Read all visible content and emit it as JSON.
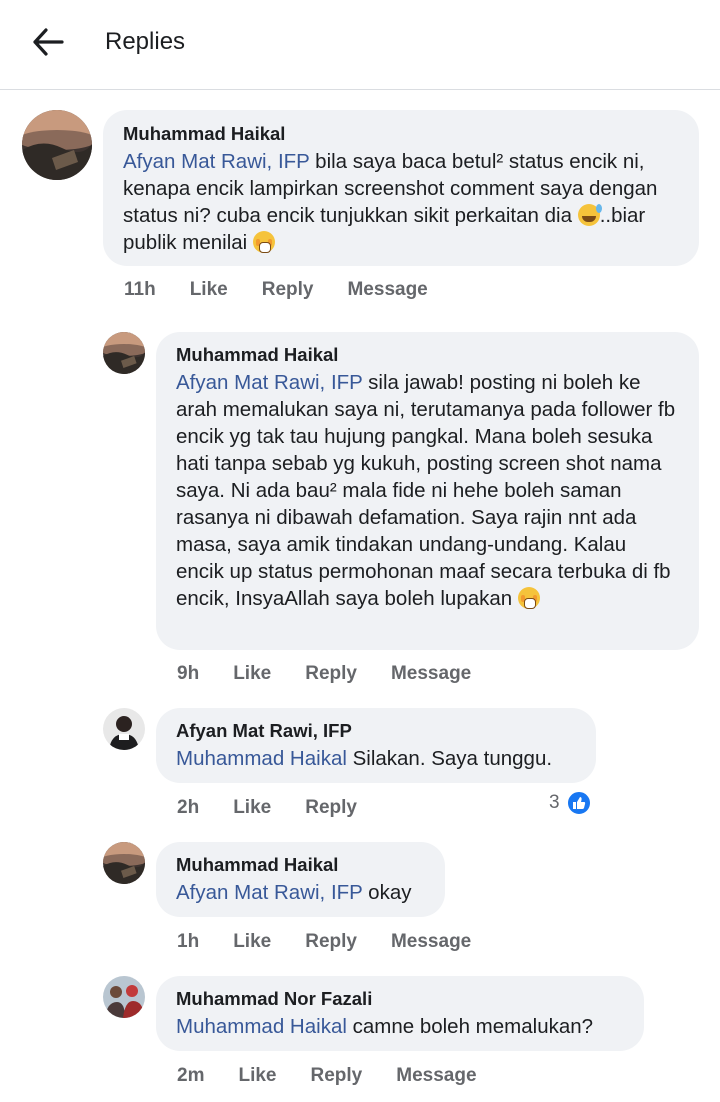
{
  "header": {
    "title": "Replies",
    "back_icon": "arrow-left-icon"
  },
  "comments": [
    {
      "author": "Muhammad Haikal",
      "mention": "Afyan Mat Rawi, IFP",
      "text_a": "  bila saya baca betul² status encik ni, kenapa encik lampirkan screenshot comment saya dengan status ni? cuba encik tunjukkan sikit perkaitan dia ",
      "text_b": "..biar publik menilai ",
      "time": "11h",
      "like": "Like",
      "reply": "Reply",
      "message": "Message"
    },
    {
      "author": "Muhammad Haikal",
      "mention": "Afyan Mat Rawi, IFP",
      "text": " sila jawab!  posting ni boleh ke arah memalukan saya ni, terutamanya pada follower fb encik yg tak tau hujung pangkal. Mana boleh sesuka hati tanpa sebab yg kukuh, posting screen shot nama saya.  Ni ada bau² mala fide ni hehe boleh saman rasanya ni dibawah defamation. Saya rajin nnt ada masa, saya amik tindakan undang-undang. Kalau encik up status permohonan maaf secara terbuka di fb encik, InsyaAllah saya boleh lupakan ",
      "time": "9h",
      "like": "Like",
      "reply": "Reply",
      "message": "Message"
    },
    {
      "author": "Afyan Mat Rawi, IFP",
      "mention": "Muhammad Haikal",
      "text": " Silakan. Saya tunggu.",
      "time": "2h",
      "like": "Like",
      "reply": "Reply",
      "reaction_count": "3"
    },
    {
      "author": "Muhammad Haikal",
      "mention": "Afyan Mat Rawi, IFP",
      "text": " okay",
      "time": "1h",
      "like": "Like",
      "reply": "Reply",
      "message": "Message"
    },
    {
      "author": "Muhammad Nor Fazali",
      "mention": "Muhammad Haikal",
      "text": " camne boleh memalukan?",
      "time": "2m",
      "like": "Like",
      "reply": "Reply",
      "message": "Message"
    }
  ],
  "colors": {
    "mention": "#385898",
    "bubble": "#f0f2f5",
    "like_blue": "#1877f2",
    "meta": "#65676b"
  }
}
